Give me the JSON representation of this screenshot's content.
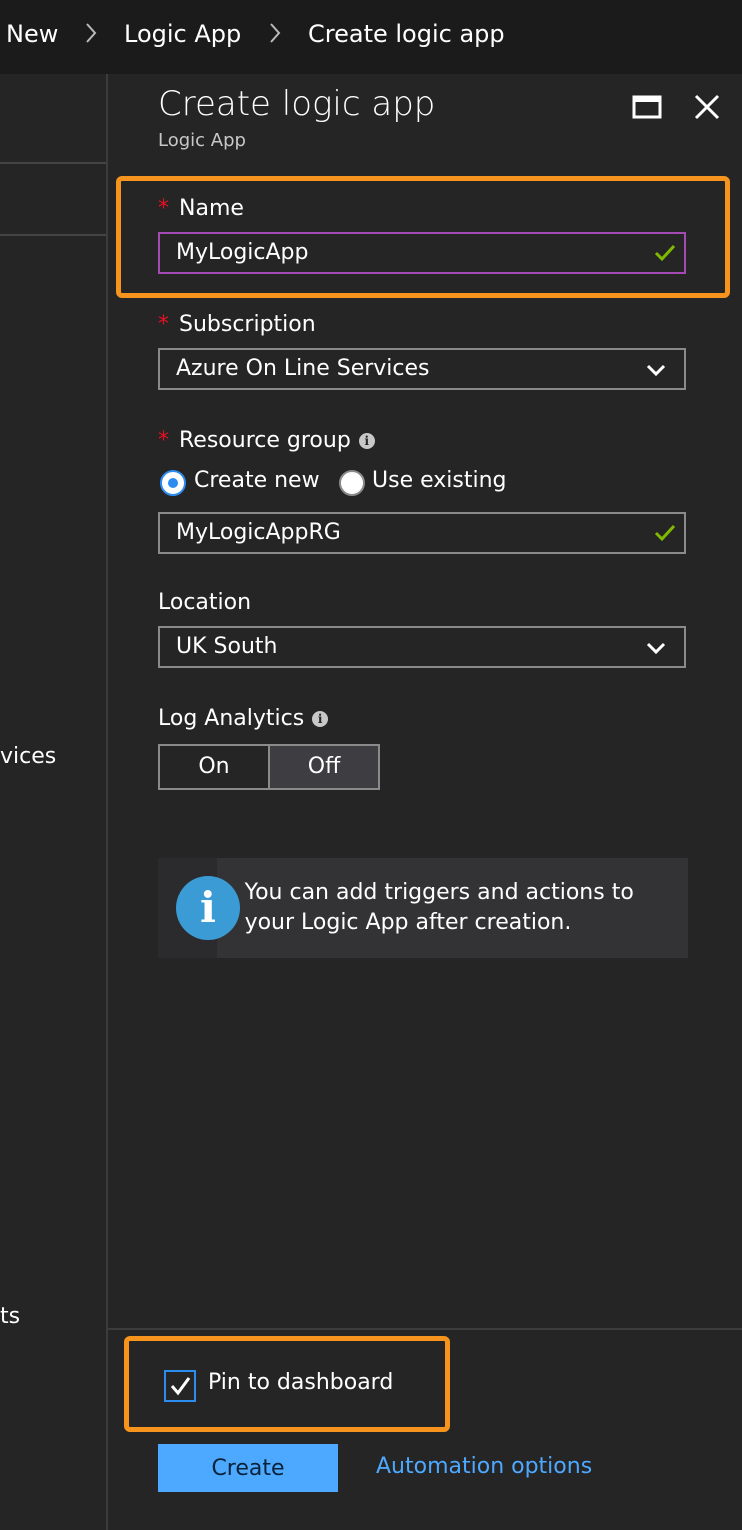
{
  "breadcrumb": {
    "items": [
      "New",
      "Logic App",
      "Create logic app"
    ]
  },
  "left_pane": {
    "partial_items": [
      "vices",
      "ts"
    ]
  },
  "blade": {
    "title": "Create logic app",
    "subtitle": "Logic App",
    "controls": {
      "maximize_icon": "maximize-icon",
      "close_icon": "close-icon"
    }
  },
  "form": {
    "required_marker": "*",
    "name": {
      "label": "Name",
      "value": "MyLogicApp",
      "valid": true
    },
    "subscription": {
      "label": "Subscription",
      "selected": "Azure On Line Services"
    },
    "resource_group": {
      "label": "Resource group",
      "options": [
        "Create new",
        "Use existing"
      ],
      "selected_option": "Create new",
      "value": "MyLogicAppRG",
      "valid": true
    },
    "location": {
      "label": "Location",
      "selected": "UK South"
    },
    "log_analytics": {
      "label": "Log Analytics",
      "options": [
        "On",
        "Off"
      ],
      "selected": "Off"
    }
  },
  "info_box": {
    "text": "You can add triggers and actions to your Logic App after creation."
  },
  "footer": {
    "pin_label": "Pin to dashboard",
    "pin_checked": true,
    "create_label": "Create",
    "automation_label": "Automation options"
  },
  "colors": {
    "accent": "#4da9ff",
    "highlight": "#f7941d",
    "required": "#e81123",
    "valid_check": "#7fba00",
    "focus_border": "#a34bb3"
  }
}
